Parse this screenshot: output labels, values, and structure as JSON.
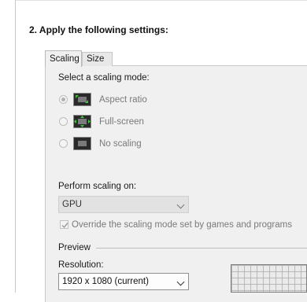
{
  "section": {
    "title": "2. Apply the following settings:"
  },
  "tabs": [
    {
      "label": "Scaling",
      "active": true
    },
    {
      "label": "Size",
      "active": false
    }
  ],
  "scaling": {
    "select_mode_label": "Select a scaling mode:",
    "modes": [
      {
        "label": "Aspect ratio",
        "icon": "aspect-ratio-icon",
        "selected": true,
        "enabled": false
      },
      {
        "label": "Full-screen",
        "icon": "full-screen-icon",
        "selected": false,
        "enabled": false
      },
      {
        "label": "No scaling",
        "icon": "no-scaling-icon",
        "selected": false,
        "enabled": false
      }
    ]
  },
  "perform": {
    "label": "Perform scaling on:",
    "value": "GPU"
  },
  "override": {
    "label": "Override the scaling mode set by games and programs",
    "checked": true
  },
  "preview": {
    "label": "Preview",
    "resolution_label": "Resolution:",
    "resolution_value": "1920 x 1080 (current)"
  },
  "colors": {
    "icon_arrow": "#3ec43e",
    "panel_bg": "#f0f0f0"
  }
}
